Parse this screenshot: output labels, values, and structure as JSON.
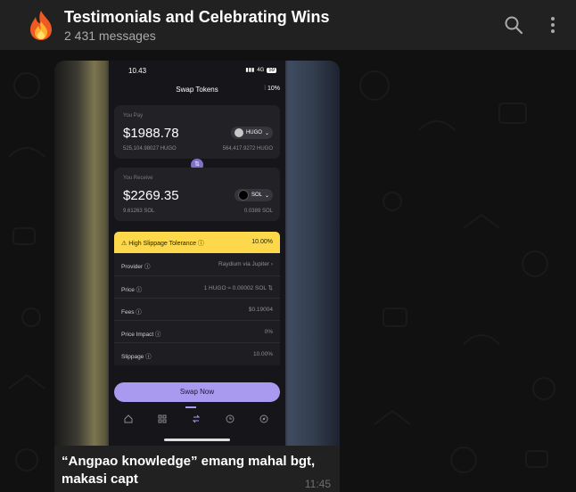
{
  "header": {
    "title": "Testimonials and Celebrating Wins",
    "subtitle": "2 431 messages",
    "avatar_icon": "fire-icon"
  },
  "message": {
    "caption_line1": "“Angpao knowledge” emang mahal bgt,",
    "caption_line2": "makasi capt",
    "time": "11:45"
  },
  "phone": {
    "status_time": "10.43",
    "status_network": "4G",
    "status_battery": "59",
    "title": "Swap Tokens",
    "slippage_short": "10%",
    "pay": {
      "label": "You Pay",
      "amount": "$1988.78",
      "token": "HUGO",
      "sub_left": "525,104.98027 HUGO",
      "sub_right": "564,417.9272 HUGO"
    },
    "receive": {
      "label": "You Receive",
      "amount": "$2269.35",
      "token": "SOL",
      "sub_left": "9.61263 SOL",
      "sub_right": "0.0389 SOL"
    },
    "warning": {
      "label": "⚠ High Slippage Tolerance ⓘ",
      "value": "10.00%"
    },
    "rows": [
      {
        "k": "Provider ⓘ",
        "v": "Raydium via Jupiter ›"
      },
      {
        "k": "Price ⓘ",
        "v": "1 HUGO ≈ 0.00002 SOL ⇅"
      },
      {
        "k": "Fees ⓘ",
        "v": "$0.19004"
      },
      {
        "k": "Price Impact ⓘ",
        "v": "0%"
      },
      {
        "k": "Slippage ⓘ",
        "v": "10.00%"
      }
    ],
    "swap_button": "Swap Now"
  },
  "colors": {
    "accent": "#a99af0",
    "warning": "#fdd84a",
    "header_bg": "#212121"
  }
}
